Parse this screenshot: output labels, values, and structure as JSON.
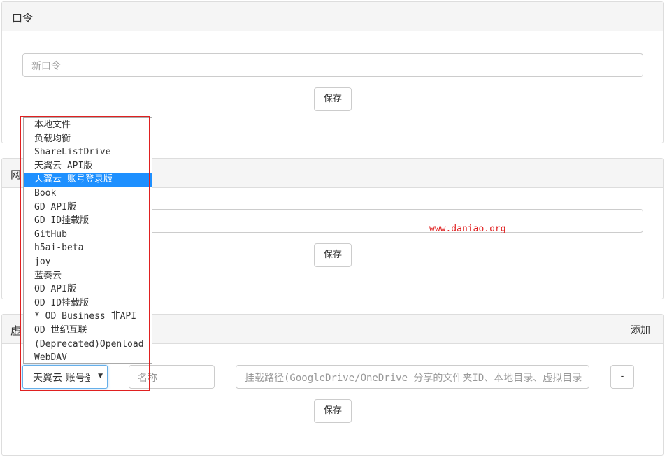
{
  "password_panel": {
    "title": "口令",
    "input_placeholder": "新口令",
    "save_label": "保存"
  },
  "second_panel": {
    "title_partial": "网",
    "save_label": "保存"
  },
  "virtual_panel": {
    "title_partial": "虚",
    "add_label": "添加",
    "drive_type_selected": "天翼云 账号登录版",
    "name_placeholder": "名称",
    "path_placeholder": "挂载路径(GoogleDrive/OneDrive 分享的文件夹ID、本地目录、虚拟目录",
    "remove_label": "-",
    "save_label": "保存"
  },
  "dropdown": {
    "options": [
      "本地文件",
      "负载均衡",
      "ShareListDrive",
      "天翼云 API版",
      "天翼云 账号登录版",
      "Book",
      "GD API版",
      "GD ID挂载版",
      "GitHub",
      "h5ai-beta",
      "joy",
      "蓝奏云",
      "OD API版",
      "OD ID挂载版",
      "* OD Business 非API",
      "OD 世纪互联",
      "(Deprecated)Openload",
      "WebDAV"
    ],
    "selected_index": 4
  },
  "watermark": "www.daniao.org",
  "colors": {
    "highlight": "#1e90ff",
    "annotation_red": "#e02020",
    "focus_border": "#66afe9"
  }
}
